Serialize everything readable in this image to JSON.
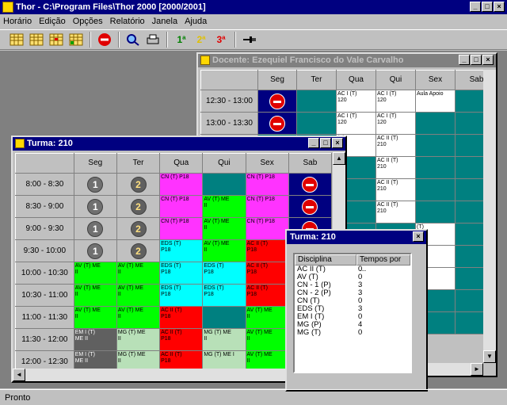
{
  "app": {
    "title": "Thor - C:\\Program Files\\Thor 2000 [2000/2001]"
  },
  "menu": [
    "Horário",
    "Edição",
    "Opções",
    "Relatório",
    "Janela",
    "Ajuda"
  ],
  "toolbar": {
    "b1": "1ª",
    "b2": "2ª",
    "b3": "3ª"
  },
  "status": "Pronto",
  "colors": {
    "teal": "#008080",
    "magenta": "#ff33ff",
    "cyan": "#00ffff",
    "green": "#00ff00",
    "red": "#ff0000",
    "navy": "#000080",
    "lightgreen": "#b8e0b8",
    "dark": "#606060"
  },
  "docente": {
    "title": "Docente: Ezequiel Francisco do Vale Carvalho",
    "days": [
      "Seg",
      "Ter",
      "Qua",
      "Qui",
      "Sex",
      "Sab"
    ],
    "rows": [
      {
        "time": "12:30 - 13:00",
        "cells": [
          "X",
          "",
          "AC I (T)\n120",
          "AC I (T)\n120",
          "Aula Apoio",
          ""
        ]
      },
      {
        "time": "13:00 - 13:30",
        "cells": [
          "X",
          "",
          "AC I (T)\n120",
          "AC I (T)\n120",
          "",
          ""
        ]
      },
      {
        "time": "",
        "cells": [
          "",
          "",
          "(T)",
          "AC II (T)\n210",
          "",
          ""
        ]
      },
      {
        "time": "",
        "cells": [
          "",
          "",
          "",
          "AC II (T)\n210",
          "",
          ""
        ]
      },
      {
        "time": "",
        "cells": [
          "",
          "",
          "",
          "AC II (T)\n210",
          "",
          ""
        ]
      },
      {
        "time": "",
        "cells": [
          "",
          "",
          "",
          "AC II (T)\n210",
          "",
          ""
        ]
      },
      {
        "time": "",
        "cells": [
          "",
          "",
          "",
          "",
          "(T)",
          ""
        ]
      },
      {
        "time": "",
        "cells": [
          "",
          "",
          "",
          "",
          "(T)",
          ""
        ]
      },
      {
        "time": "",
        "cells": [
          "",
          "",
          "",
          "",
          "(T)",
          ""
        ]
      },
      {
        "time": "",
        "cells": [
          "",
          "",
          "",
          "",
          "",
          ""
        ]
      },
      {
        "time": "",
        "cells": [
          "",
          "",
          "",
          "",
          "",
          ""
        ]
      }
    ]
  },
  "turma": {
    "title": "Turma: 210",
    "days": [
      "Seg",
      "Ter",
      "Qua",
      "Qui",
      "Sex",
      "Sab"
    ],
    "rows": [
      {
        "time": "8:00 - 8:30",
        "cells": [
          {
            "t": "1"
          },
          {
            "t": "2"
          },
          {
            "c": "magenta",
            "v": "CN (T) P18"
          },
          {
            "c": "teal",
            "v": ""
          },
          {
            "c": "magenta",
            "v": "CN (T) P18"
          },
          {
            "t": "X"
          }
        ]
      },
      {
        "time": "8:30 - 9:00",
        "cells": [
          {
            "t": "1"
          },
          {
            "t": "2"
          },
          {
            "c": "magenta",
            "v": "CN (T) P18"
          },
          {
            "c": "green",
            "v": "AV (T) ME\nII"
          },
          {
            "c": "magenta",
            "v": "CN (T) P18"
          },
          {
            "t": "X"
          }
        ]
      },
      {
        "time": "9:00 - 9:30",
        "cells": [
          {
            "t": "1"
          },
          {
            "t": "2"
          },
          {
            "c": "magenta",
            "v": "CN (T) P18"
          },
          {
            "c": "green",
            "v": "AV (T) ME\nII"
          },
          {
            "c": "magenta",
            "v": "CN (T) P18"
          },
          {
            "t": "X"
          }
        ]
      },
      {
        "time": "9:30 - 10:00",
        "cells": [
          {
            "t": "1"
          },
          {
            "t": "2"
          },
          {
            "c": "cyan",
            "v": "EDS (T)\nP18"
          },
          {
            "c": "green",
            "v": "AV (T) ME\nII"
          },
          {
            "c": "red",
            "v": "AC II (T)\nP18"
          },
          {
            "t": "X"
          }
        ]
      },
      {
        "time": "10:00 - 10:30",
        "cells": [
          {
            "c": "green",
            "v": "AV (T) ME\nII"
          },
          {
            "c": "green",
            "v": "AV (T) ME\nII"
          },
          {
            "c": "cyan",
            "v": "EDS (T)\nP18"
          },
          {
            "c": "cyan",
            "v": "EDS (T)\nP18"
          },
          {
            "c": "red",
            "v": "AC II (T)\nP18"
          },
          {
            "t": "X"
          }
        ]
      },
      {
        "time": "10:30 - 11:00",
        "cells": [
          {
            "c": "green",
            "v": "AV (T) ME\nII"
          },
          {
            "c": "green",
            "v": "AV (T) ME\nII"
          },
          {
            "c": "cyan",
            "v": "EDS (T)\nP18"
          },
          {
            "c": "cyan",
            "v": "EDS (T)\nP18"
          },
          {
            "c": "red",
            "v": "AC II (T)\nP18"
          },
          {
            "t": "X"
          }
        ]
      },
      {
        "time": "11:00 - 11:30",
        "cells": [
          {
            "c": "green",
            "v": "AV (T) ME\nII"
          },
          {
            "c": "green",
            "v": "AV (T) ME\nII"
          },
          {
            "c": "red",
            "v": "AC II (T)\nP18"
          },
          {
            "c": "teal",
            "v": ""
          },
          {
            "c": "green",
            "v": "AV (T) ME\nII"
          },
          {
            "t": "X"
          }
        ]
      },
      {
        "time": "11:30 - 12:00",
        "cells": [
          {
            "c": "dark",
            "v": "EM I (T)\nME II"
          },
          {
            "c": "lightgreen",
            "v": "MG (T) ME\nII"
          },
          {
            "c": "red",
            "v": "AC II (T)\nP18"
          },
          {
            "c": "lightgreen",
            "v": "MG (T) ME\nII"
          },
          {
            "c": "green",
            "v": "AV (T) ME\nII"
          },
          {
            "t": "X"
          }
        ]
      },
      {
        "time": "12:00 - 12:30",
        "cells": [
          {
            "c": "dark",
            "v": "EM I (T)\nME II"
          },
          {
            "c": "lightgreen",
            "v": "MG (T) ME\nII"
          },
          {
            "c": "red",
            "v": "AC II (T)\nP18"
          },
          {
            "c": "lightgreen",
            "v": "MG (T) ME I"
          },
          {
            "c": "green",
            "v": "AV (T) ME\nII"
          },
          {
            "t": "X"
          }
        ]
      }
    ]
  },
  "turma_list": {
    "title": "Turma: 210",
    "headers": [
      "Disciplina",
      "Tempos por ..."
    ],
    "rows": [
      [
        "AC II (T)",
        "0"
      ],
      [
        "AV (T)",
        "0"
      ],
      [
        "CN - 1 (P)",
        "3"
      ],
      [
        "CN - 2 (P)",
        "3"
      ],
      [
        "CN (T)",
        "0"
      ],
      [
        "EDS (T)",
        "3"
      ],
      [
        "EM I (T)",
        "0"
      ],
      [
        "MG (P)",
        "4"
      ],
      [
        "MG (T)",
        "0"
      ]
    ]
  }
}
